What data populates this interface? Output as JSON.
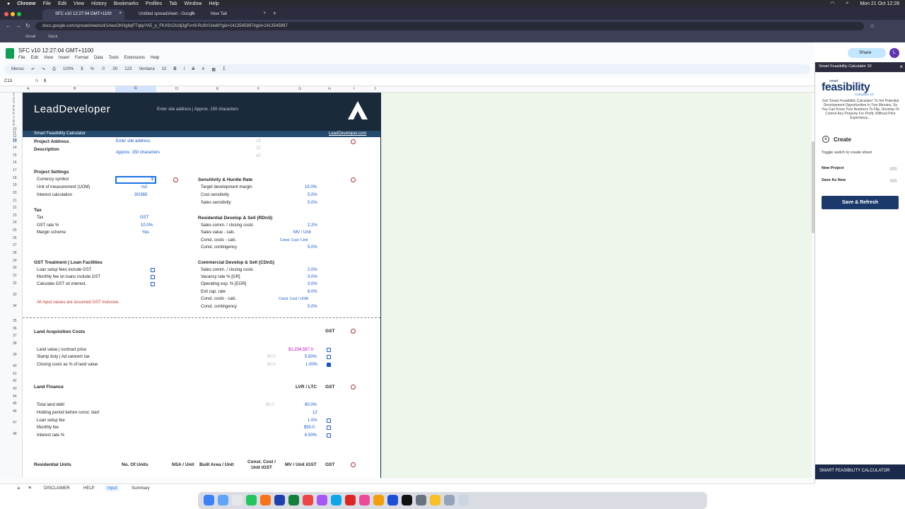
{
  "mac": {
    "menus": [
      "Chrome",
      "File",
      "Edit",
      "View",
      "History",
      "Bookmarks",
      "Profiles",
      "Tab",
      "Window",
      "Help"
    ],
    "clock": "Mon 21 Oct 12:28"
  },
  "tabs": [
    {
      "label": "SFC v10 12:27:04 GMT+1100"
    },
    {
      "label": "Untitled spreadsheet - Google"
    },
    {
      "label": "New Tab"
    }
  ],
  "url": "docs.google.com/spreadsheets/d/1AwxOKNg6qFTqkpYA5_p_FKX91OUdj3gFvrr9-Rc8VU/edit?gid=1413545997#gid=1413545997",
  "bookmarks": [
    "Gmail",
    "Slack"
  ],
  "doc": {
    "title": "SFC v10 12:27:04 GMT+1100",
    "menus": [
      "File",
      "Edit",
      "View",
      "Insert",
      "Format",
      "Data",
      "Tools",
      "Extensions",
      "Help"
    ],
    "toolbar": {
      "menus": "Menus",
      "zoom": "100%",
      "currency": "$",
      "percent": "%",
      "dec1": ".0",
      "dec2": ".00",
      "fmt": "123",
      "font": "Verdana",
      "size": "10"
    },
    "share": "Share",
    "avatar": "L",
    "cellref": "C13",
    "formula": "$"
  },
  "columns": [
    "A",
    "B",
    "C",
    "D",
    "E",
    "F",
    "G",
    "H",
    "I",
    "J"
  ],
  "rows": [
    "1",
    "2",
    "3",
    "4",
    "5",
    "6",
    "7",
    "8",
    "9",
    "10",
    "11",
    "12",
    "13",
    "14",
    "15",
    "16",
    "17",
    "18",
    "19",
    "20",
    "21",
    "22",
    "23",
    "24",
    "25",
    "26",
    "27",
    "28",
    "29",
    "30",
    "31",
    "32",
    "33",
    "34",
    "35",
    "36",
    "37",
    "38",
    "39",
    "40",
    "41",
    "42",
    "43",
    "44",
    "45",
    "46",
    "47",
    "48"
  ],
  "banner": {
    "logo": "LeadDeveloper",
    "placeholder": "Enter site address | Approx. 150 characters",
    "subtitle": "Smart Feasibility Calculator",
    "site": "LeadDeveloper.com"
  },
  "project": {
    "address_label": "Project Address",
    "address_value": "Enter site address",
    "address_count": "18",
    "desc_label": "Description",
    "desc_value": "Approx. 150 characters",
    "desc_count1": "22",
    "desc_count2": "40"
  },
  "settings": {
    "heading": "Project Settings",
    "currency_label": "Currency symbol",
    "currency_value": "$",
    "uom_label": "Unit of measurement (UOM)",
    "uom_value": "m2",
    "interest_label": "Interest calculation",
    "interest_value": "30/365"
  },
  "tax": {
    "heading": "Tax",
    "tax_label": "Tax",
    "tax_value": "GST",
    "rate_label": "GST rate %",
    "rate_value": "10.0%",
    "margin_label": "Margin scheme",
    "margin_value": "Yes"
  },
  "gst": {
    "heading": "GST Treatment | Loan Facilities",
    "items": [
      "Loan setup fees include GST",
      "Monthly fee on loans include GST",
      "Calculate GST on interest."
    ],
    "note": "All input values are assumed GST inclusive."
  },
  "sensitivity": {
    "heading": "Sensitivity & Hurdle Rate",
    "items": [
      {
        "label": "Target development margin",
        "value": "15.0%"
      },
      {
        "label": "Cost sensitivity",
        "value": "5.0%"
      },
      {
        "label": "Sales sensitivity",
        "value": "5.0%"
      }
    ]
  },
  "rdns": {
    "heading": "Residential Develop & Sell (RDnS)",
    "items": [
      {
        "label": "Sales comm. / closing costs",
        "value": "2.2%"
      },
      {
        "label": "Sales value - calc.",
        "value": "MV / Unit"
      },
      {
        "label": "Const. costs - calc.",
        "value": "Const. Cost / Unit"
      },
      {
        "label": "Const. contingency",
        "value": "5.0%"
      }
    ]
  },
  "cdns": {
    "heading": "Commercial Develop & Sell (CDnS)",
    "items": [
      {
        "label": "Sales comm. / closing costs",
        "value": "2.0%"
      },
      {
        "label": "Vacancy rate % [GR]",
        "value": "3.0%"
      },
      {
        "label": "Operating exp. % [EGR]",
        "value": "3.0%"
      },
      {
        "label": "Exit cap. rate",
        "value": "8.0%"
      },
      {
        "label": "Const. costs - calc.",
        "value": "Const. Cost / UOM"
      },
      {
        "label": "Const. contingency",
        "value": "5.0%"
      }
    ]
  },
  "land_acq": {
    "heading": "Land Acquisition Costs",
    "gst": "GST",
    "items": [
      {
        "label": "Land value |  contract price",
        "calc": "",
        "value": "$1,234,567.0"
      },
      {
        "label": "Stamp duty | Ad valorem tax",
        "calc": "$0.0",
        "value": "5.50%"
      },
      {
        "label": "Closing costs as % of land value",
        "calc": "$0.0",
        "value": "1.00%"
      }
    ]
  },
  "land_fin": {
    "heading": "Land Finance",
    "lvr": "LVR / LTC",
    "gst": "GST",
    "items": [
      {
        "label": "Total land debt",
        "calc": "$0.0",
        "value": "80.0%"
      },
      {
        "label": "Holding period before const. start",
        "calc": "",
        "value": "12"
      },
      {
        "label": "Loan setup fee",
        "calc": "",
        "value": "1.0%"
      },
      {
        "label": "Monthly fee",
        "calc": "",
        "value": "$50.0"
      },
      {
        "label": "Interest rate %",
        "calc": "",
        "value": "6.50%"
      }
    ]
  },
  "res_units": {
    "heading": "Residential Units",
    "cols": [
      "No. Of Units",
      "NSA / Unit",
      "Built Area / Unit",
      "Const. Cost / Unit iGST",
      "MV / Unit iGST",
      "GST"
    ]
  },
  "sheet_tabs": [
    "DISCLAIMER",
    "HELP",
    "Input",
    "Summary"
  ],
  "sidebar": {
    "title": "Smart Feasibility Calculator 10",
    "brand_small": "smart",
    "brand": "feasibility",
    "brand_sub": "Calculator 10",
    "desc": "Get 'Smart Feasibility Calculator' To Vet Potential Development Opportunities In Two Minutes, So You Can Know Your Numbers To Flip, Develop Or Control Any Property For Profit, Without Prior Experience...",
    "create": "Create",
    "toggle_hint": "Toggle switch to create sheet",
    "new_project": "New Project",
    "save_as_new": "Save As New",
    "save_refresh": "Save & Refresh",
    "footer": "SMART FEASIBILITY CALCULATOR"
  },
  "colors": {
    "banner": "#1b2a3a",
    "accent": "#1155cc",
    "save": "#1b3a6b",
    "magenta": "#c000c0"
  }
}
